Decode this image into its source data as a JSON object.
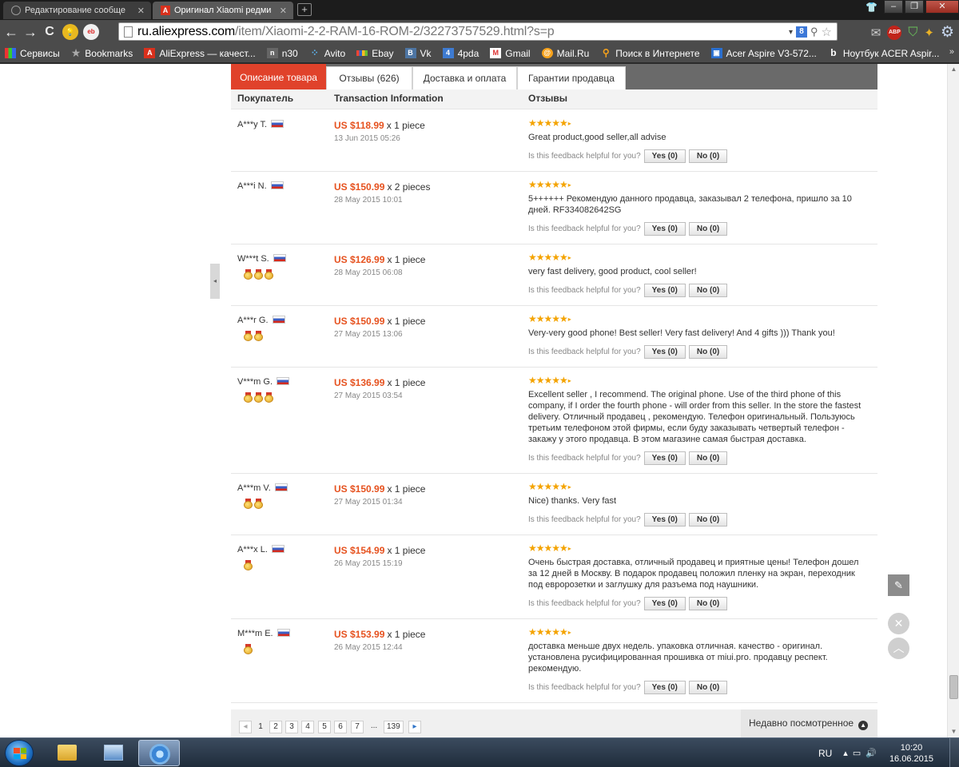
{
  "browser": {
    "tabs": [
      {
        "title": "Редактирование сообще",
        "active": false
      },
      {
        "title": "Оригинал Xiaomi редми",
        "active": true
      }
    ],
    "url_host": "ru.aliexpress.com",
    "url_path": "/item/Xiaomi-2-2-RAM-16-ROM-2/32273757529.html?s=p",
    "bookmarks": [
      {
        "label": "Сервисы",
        "icon": "apps-grid-icon"
      },
      {
        "label": "Bookmarks",
        "icon": "star-icon"
      },
      {
        "label": "AliExpress — качест...",
        "icon": "aliexpress-icon"
      },
      {
        "label": "n30",
        "icon": "n30-icon"
      },
      {
        "label": "Avito",
        "icon": "avito-icon"
      },
      {
        "label": "Ebay",
        "icon": "ebay-icon"
      },
      {
        "label": "Vk",
        "icon": "vk-icon"
      },
      {
        "label": "4pda",
        "icon": "4pda-icon"
      },
      {
        "label": "Gmail",
        "icon": "gmail-icon"
      },
      {
        "label": "Mail.Ru",
        "icon": "mailru-icon"
      },
      {
        "label": "Поиск в Интернете",
        "icon": "search-engine-icon"
      },
      {
        "label": "Acer Aspire V3-572...",
        "icon": "acer-icon"
      },
      {
        "label": "Ноутбук ACER Aspir...",
        "icon": "bing-icon"
      }
    ],
    "bookmarks_more": "»"
  },
  "product_tabs": [
    {
      "label": "Описание товара",
      "active": true
    },
    {
      "label": "Отзывы (626)",
      "active": false
    },
    {
      "label": "Доставка и оплата",
      "active": false
    },
    {
      "label": "Гарантии продавца",
      "active": false
    }
  ],
  "columns": {
    "buyer": "Покупатель",
    "transaction": "Transaction Information",
    "feedback": "Отзывы"
  },
  "reviews": [
    {
      "buyer": "A***y T.",
      "medals": 0,
      "price": "US $118.99",
      "qty": "x 1 piece",
      "date": "13 Jun 2015 05:26",
      "rating": 5,
      "text": "Great product,good seller,all advise"
    },
    {
      "buyer": "A***i N.",
      "medals": 0,
      "price": "US $150.99",
      "qty": "x 2 pieces",
      "date": "28 May 2015 10:01",
      "rating": 5,
      "text": "5++++++ Рекомендую данного продавца, заказывал 2 телефона, пришло за 10 дней. RF334082642SG"
    },
    {
      "buyer": "W***t S.",
      "medals": 3,
      "price": "US $126.99",
      "qty": "x 1 piece",
      "date": "28 May 2015 06:08",
      "rating": 5,
      "text": "very fast delivery, good product, cool seller!"
    },
    {
      "buyer": "A***r G.",
      "medals": 2,
      "price": "US $150.99",
      "qty": "x 1 piece",
      "date": "27 May 2015 13:06",
      "rating": 5,
      "text": "Very-very good phone! Best seller! Very fast delivery! And 4 gifts ))) Thank you!"
    },
    {
      "buyer": "V***m G.",
      "medals": 3,
      "price": "US $136.99",
      "qty": "x 1 piece",
      "date": "27 May 2015 03:54",
      "rating": 5,
      "text": "Excellent seller , I recommend. The original phone. Use of the third phone of this company, if I order the fourth phone - will order from this seller. In the store the fastest delivery. Отличный продавец , рекомендую. Телефон оригинальный. Пользуюсь третьим телефоном этой фирмы, если буду заказывать четвертый телефон - закажу у этого продавца. В этом магазине самая быстрая доставка."
    },
    {
      "buyer": "A***m V.",
      "medals": 2,
      "price": "US $150.99",
      "qty": "x 1 piece",
      "date": "27 May 2015 01:34",
      "rating": 5,
      "text": "Nice) thanks. Very fast"
    },
    {
      "buyer": "A***x L.",
      "medals": 1,
      "price": "US $154.99",
      "qty": "x 1 piece",
      "date": "26 May 2015 15:19",
      "rating": 5,
      "text": "Очень быстрая доставка, отличный продавец и приятные цены! Телефон дошел за 12 дней в Москву. В подарок продавец положил пленку на экран, переходник под евророзетки и заглушку для разъема под наушники."
    },
    {
      "buyer": "M***m E.",
      "medals": 1,
      "price": "US $153.99",
      "qty": "x 1 piece",
      "date": "26 May 2015 12:44",
      "rating": 5,
      "text": "доставка меньше двух недель. упаковка отличная. качество - оригинал. установлена русифицированная прошивка от miui.pro. продавцу респект. рекомендую."
    }
  ],
  "helpful": {
    "question": "Is this feedback helpful for you?",
    "yes": "Yes (0)",
    "no": "No (0)"
  },
  "pagination": {
    "current": "1",
    "pages": [
      "2",
      "3",
      "4",
      "5",
      "6",
      "7"
    ],
    "ellipsis": "...",
    "last": "139"
  },
  "recently_viewed": "Недавно посмотренное",
  "taskbar": {
    "lang": "RU",
    "time": "10:20",
    "date": "16.06.2015"
  },
  "colors": {
    "accent": "#e0422b",
    "price": "#e6521f",
    "star": "#f4a300"
  }
}
